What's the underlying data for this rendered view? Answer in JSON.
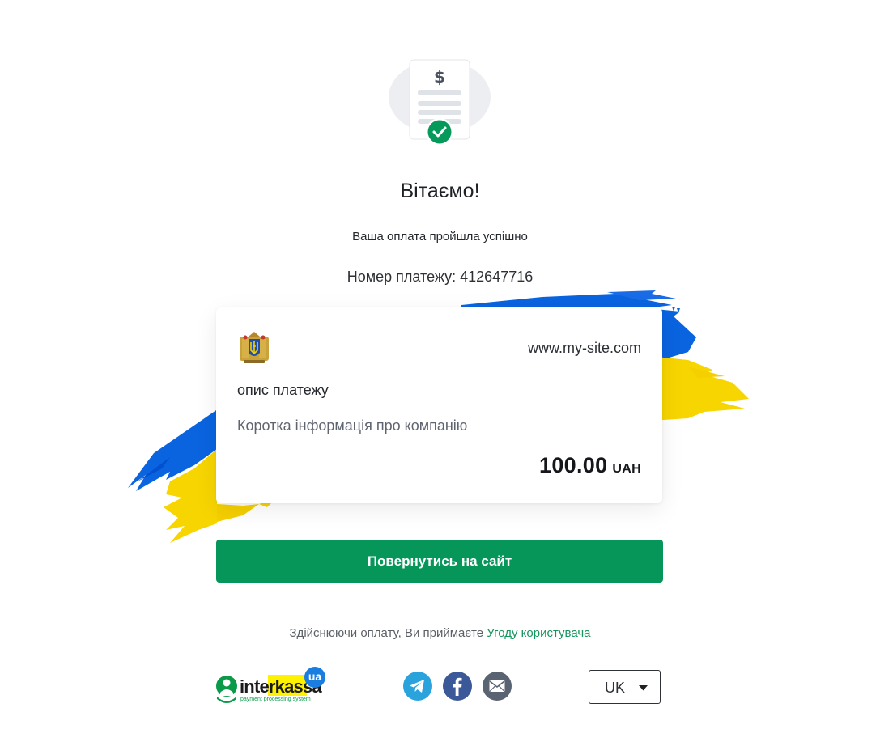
{
  "success": {
    "title": "Вітаємо!",
    "subtitle": "Ваша оплата пройшла успішно",
    "payment_number_label": "Номер платежу: 412647716"
  },
  "card": {
    "site": "www.my-site.com",
    "description": "опис платежу",
    "company_info": "Коротка інформація про компанію",
    "amount": "100.00",
    "currency": "UAH"
  },
  "actions": {
    "return_label": "Повернутись на сайт"
  },
  "footer": {
    "terms_prefix": "Здійснюючи оплату, Ви приймаєте",
    "terms_link": "Угоду користувача",
    "logo_text": "interkassa",
    "logo_badge": "ua",
    "logo_tagline": "payment processing system",
    "language": "UK"
  },
  "icons": {
    "hero": "invoice-check-icon",
    "coat_of_arms": "ukraine-coat-of-arms-icon",
    "telegram": "telegram-icon",
    "facebook": "facebook-icon",
    "email": "email-icon",
    "caret": "caret-down-icon"
  },
  "colors": {
    "accent_green": "#06965a",
    "link_green": "#14955b",
    "flag_blue": "#0057b8",
    "flag_yellow": "#ffd700"
  }
}
